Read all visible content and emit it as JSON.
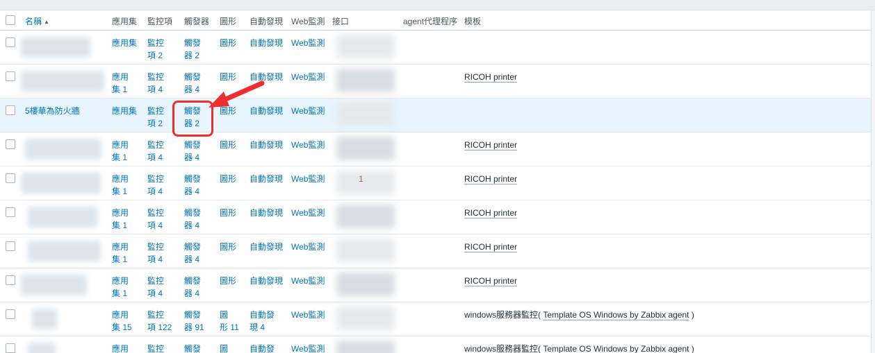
{
  "columns": {
    "name": "名稱",
    "apps": "應用集",
    "items": "監控項",
    "triggers": "觸發器",
    "graphs": "圖形",
    "discovery": "自動發現",
    "web": "Web監測",
    "interface": "接口",
    "agent_proxy": "agent代理程序",
    "templates": "模板"
  },
  "sort_indicator": "▲",
  "rows": [
    {
      "name": "",
      "apps": "應用集",
      "items": "監控\n項 2",
      "triggers": "觸發\n器 2",
      "graphs": "圖形",
      "discovery": "自動發現",
      "web": "Web監測",
      "template": "",
      "template_sub": "",
      "interface_text": ""
    },
    {
      "name": "",
      "apps": "應用\n集 1",
      "items": "監控\n項 4",
      "triggers": "觸發\n器 4",
      "graphs": "圖形",
      "discovery": "自動發現",
      "web": "Web監測",
      "template": "RICOH printer",
      "template_sub": "",
      "interface_text": ""
    },
    {
      "name": "5樓華為防火牆",
      "apps": "應用集",
      "items": "監控\n項 2",
      "triggers": "觸發\n器 2",
      "graphs": "圖形",
      "discovery": "自動發現",
      "web": "Web監測",
      "template": "",
      "template_sub": "",
      "interface_text": ""
    },
    {
      "name": "",
      "apps": "應用\n集 1",
      "items": "監控\n項 4",
      "triggers": "觸發\n器 4",
      "graphs": "圖形",
      "discovery": "自動發現",
      "web": "Web監測",
      "template": "RICOH printer",
      "template_sub": "",
      "interface_text": ""
    },
    {
      "name": "",
      "apps": "應用\n集 1",
      "items": "監控\n項 4",
      "triggers": "觸發\n器 4",
      "graphs": "圖形",
      "discovery": "自動發現",
      "web": "Web監測",
      "template": "RICOH printer",
      "template_sub": "",
      "interface_text": "1"
    },
    {
      "name": "",
      "apps": "應用\n集 1",
      "items": "監控\n項 4",
      "triggers": "觸發\n器 4",
      "graphs": "圖形",
      "discovery": "自動發現",
      "web": "Web監測",
      "template": "RICOH printer",
      "template_sub": "",
      "interface_text": ""
    },
    {
      "name": "",
      "apps": "應用\n集 1",
      "items": "監控\n項 4",
      "triggers": "觸發\n器 4",
      "graphs": "圖形",
      "discovery": "自動發現",
      "web": "Web監測",
      "template": "RICOH printer",
      "template_sub": "",
      "interface_text": ""
    },
    {
      "name": "",
      "apps": "應用\n集 1",
      "items": "監控\n項 4",
      "triggers": "觸發\n器 4",
      "graphs": "圖形",
      "discovery": "自動發現",
      "web": "Web監測",
      "template": "RICOH printer",
      "template_sub": "",
      "interface_text": ""
    },
    {
      "name": "",
      "apps": "應用\n集 15",
      "items": "監控\n項 122",
      "triggers": "觸發\n器 91",
      "graphs": "圖\n形 11",
      "discovery": "自動發\n現 4",
      "web": "Web監測",
      "template": "windows服務器監控",
      "template_sub": "Template OS Windows by Zabbix agent",
      "interface_text": ""
    },
    {
      "name": "",
      "apps": "應用\n集",
      "items": "監控\n項",
      "triggers": "觸發\n器",
      "graphs": "圖\n形",
      "discovery": "自動發\n現",
      "web": "Web監測",
      "template": "windows服務器監控",
      "template_sub": "Template OS Windows by Zabbix agent",
      "interface_text": ""
    }
  ],
  "colors": {
    "link": "#0275b8",
    "highlight_row": "#e8f5ff",
    "annotation": "#ec2e2e"
  }
}
